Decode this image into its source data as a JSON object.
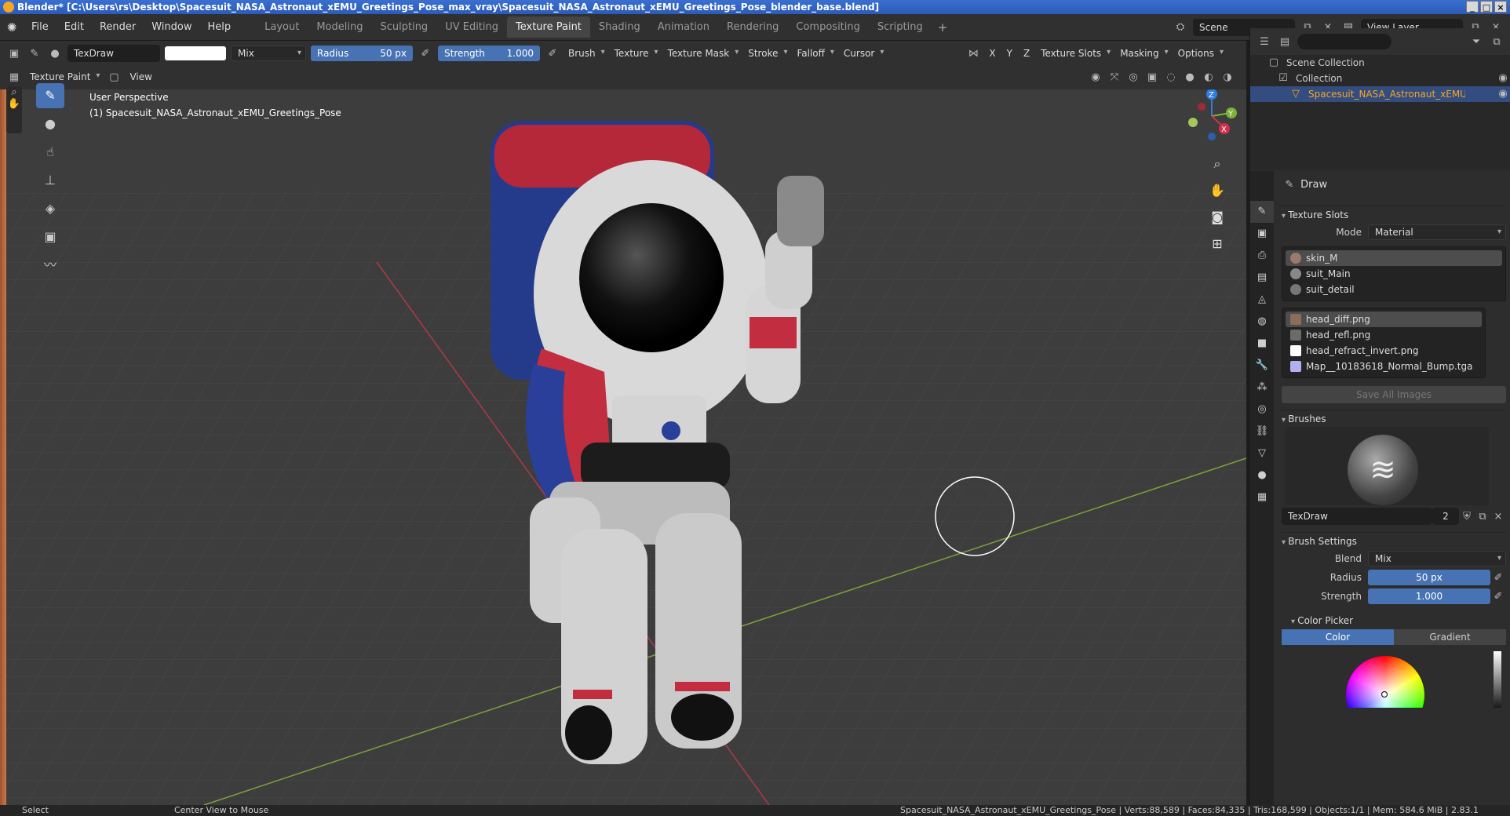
{
  "window": {
    "title": "Blender* [C:\\Users\\rs\\Desktop\\Spacesuit_NASA_Astronaut_xEMU_Greetings_Pose_max_vray\\Spacesuit_NASA_Astronaut_xEMU_Greetings_Pose_blender_base.blend]",
    "btn_min": "_",
    "btn_max": "□",
    "btn_close": "×"
  },
  "menu": {
    "items": [
      "File",
      "Edit",
      "Render",
      "Window",
      "Help"
    ]
  },
  "workspaces": {
    "tabs": [
      "Layout",
      "Modeling",
      "Sculpting",
      "UV Editing",
      "Texture Paint",
      "Shading",
      "Animation",
      "Rendering",
      "Compositing",
      "Scripting"
    ],
    "active": "Texture Paint",
    "add": "+"
  },
  "scene": {
    "name": "Scene",
    "view_layer": "View Layer"
  },
  "toolheader": {
    "brush_name": "TexDraw",
    "blend": "Mix",
    "radius_label": "Radius",
    "radius_value": "50 px",
    "strength_label": "Strength",
    "strength_value": "1.000",
    "menus": [
      "Brush",
      "Texture",
      "Texture Mask",
      "Stroke",
      "Falloff",
      "Cursor"
    ],
    "axes": [
      "X",
      "Y",
      "Z"
    ],
    "right_menus": [
      "Texture Slots",
      "Masking",
      "Options"
    ]
  },
  "modeheader": {
    "mode": "Texture Paint",
    "view": "View"
  },
  "viewport": {
    "perspective": "User Perspective",
    "object": "(1) Spacesuit_NASA_Astronaut_xEMU_Greetings_Pose",
    "gizmo_axes": [
      "Z",
      "Y",
      "X"
    ]
  },
  "outliner": {
    "scene_collection": "Scene Collection",
    "collection": "Collection",
    "object": "Spacesuit_NASA_Astronaut_xEMU_Greetings"
  },
  "properties": {
    "tool_name": "Draw",
    "texture_slots": {
      "heading": "Texture Slots",
      "mode_label": "Mode",
      "mode_value": "Material",
      "materials": [
        "skin_M",
        "suit_Main",
        "suit_detail"
      ],
      "images": [
        {
          "name": "head_diff.png",
          "color": "#8a6d5a"
        },
        {
          "name": "head_refl.png",
          "color": "#6b6b6b"
        },
        {
          "name": "head_refract_invert.png",
          "color": "#ffffff"
        },
        {
          "name": "Map__10183618_Normal_Bump.tga",
          "color": "#b3b0f0"
        }
      ],
      "save_all": "Save All Images"
    },
    "brushes": {
      "heading": "Brushes",
      "name": "TexDraw",
      "users": "2"
    },
    "brush_settings": {
      "heading": "Brush Settings",
      "blend_label": "Blend",
      "blend_value": "Mix",
      "radius_label": "Radius",
      "radius_value": "50 px",
      "strength_label": "Strength",
      "strength_value": "1.000"
    },
    "color_picker": {
      "heading": "Color Picker",
      "tab_color": "Color",
      "tab_gradient": "Gradient"
    }
  },
  "status": {
    "select": "Select",
    "center": "Center View to Mouse",
    "stats": "Spacesuit_NASA_Astronaut_xEMU_Greetings_Pose | Verts:88,589 | Faces:84,335 | Tris:168,599 | Objects:1/1 | Mem: 584.6 MiB | 2.83.1"
  },
  "colors": {
    "accent": "#4772b3",
    "selected_object": "#f5a623",
    "axis_x": "#d0304a",
    "axis_y": "#7fb237",
    "axis_z": "#2f7fe0"
  }
}
